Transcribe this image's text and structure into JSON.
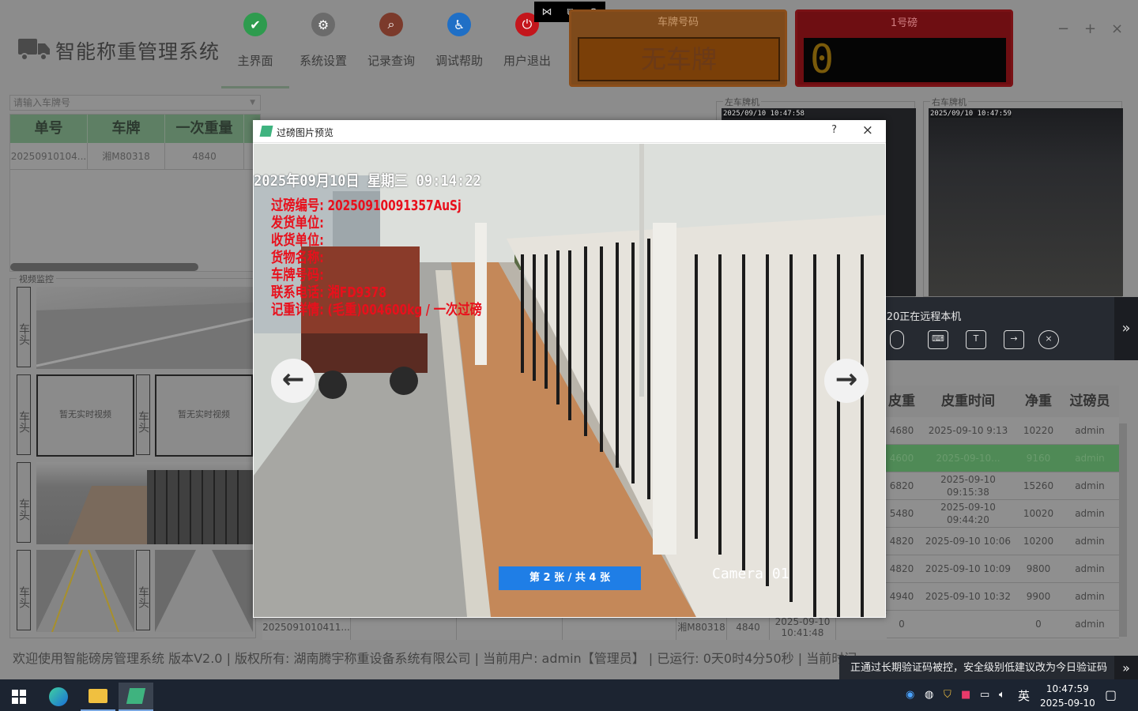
{
  "app": {
    "title": "智能称重管理系统"
  },
  "nav": [
    {
      "label": "主界面",
      "icon": "shield-icon",
      "color": "#2e9b4e"
    },
    {
      "label": "系统设置",
      "icon": "gear-icon",
      "color": "#6b6b6b"
    },
    {
      "label": "记录查询",
      "icon": "magnifier-icon",
      "color": "#7b3a2b"
    },
    {
      "label": "调试帮助",
      "icon": "accessibility-icon",
      "color": "#1f6fc6"
    },
    {
      "label": "用户退出",
      "icon": "power-icon",
      "color": "#c4161c"
    }
  ],
  "window_controls": {
    "minimize": "−",
    "maximize": "+",
    "close": "×"
  },
  "plate_panel": {
    "title": "车牌号码",
    "value": "无车牌"
  },
  "scale_panel": {
    "title": "1号磅",
    "value": "0"
  },
  "search": {
    "placeholder": "请输入车牌号"
  },
  "left_table": {
    "headers": [
      "单号",
      "车牌",
      "一次重量"
    ],
    "rows": [
      [
        "20250910104...",
        "湘M80318",
        "4840"
      ]
    ]
  },
  "video": {
    "group_label": "视频监控",
    "side_label": "车头",
    "empty_text": "暂无实时视频"
  },
  "cams": {
    "left": {
      "label": "左车牌机",
      "timestamp": "2025/09/10 10:47:58"
    },
    "right": {
      "label": "右车牌机",
      "timestamp": "2025/09/10 10:47:59"
    }
  },
  "right_table": {
    "headers": [
      "皮重",
      "皮重时间",
      "净重",
      "过磅员"
    ],
    "rows": [
      [
        "4680",
        "2025-09-10 9:13",
        "10220",
        "admin"
      ],
      [
        "4600",
        "2025-09-10...",
        "9160",
        "admin"
      ],
      [
        "6820",
        "2025-09-10 09:15:38",
        "15260",
        "admin"
      ],
      [
        "5480",
        "2025-09-10 09:44:20",
        "10020",
        "admin"
      ],
      [
        "4820",
        "2025-09-10 10:06",
        "10200",
        "admin"
      ],
      [
        "4820",
        "2025-09-10 10:09",
        "9800",
        "admin"
      ],
      [
        "4940",
        "2025-09-10 10:32",
        "9900",
        "admin"
      ],
      [
        "0",
        "",
        "0",
        "admin"
      ]
    ]
  },
  "bottom_row": {
    "id": "2025091010411...",
    "plate": "湘M80318",
    "weight": "4840",
    "time": "2025-09-10 10:41:48"
  },
  "status_bar": "欢迎使用智能磅房管理系统 版本V2.0 | 版权所有: 湖南腾宇称重设备系统有限公司 | 当前用户: admin【管理员】 | 已运行: 0天0时4分50秒 | 当前时间",
  "modal": {
    "title": "过磅图片预览",
    "help": "?",
    "close": "×",
    "pager": "第 2 张 / 共 4 张",
    "prev": "←",
    "next": "→",
    "overlay": {
      "datetime": "2025年09月10日 星期三 09:14:22",
      "lines": [
        "过磅编号: 20250910091357AuSj",
        "发货单位:",
        "收货单位:",
        "货物名称:",
        "车牌号码:",
        "联系电话: 湘FD9378",
        "记重详情: (毛重)004600kg / 一次过磅"
      ],
      "camera": "Camera 01"
    }
  },
  "remote": {
    "title": "fr...20正在远程本机"
  },
  "notice": "正通过长期验证码被控，安全级别低建议改为今日验证码",
  "taskbar": {
    "time": "10:47:59",
    "date": "2025-09-10",
    "ime": "英"
  }
}
